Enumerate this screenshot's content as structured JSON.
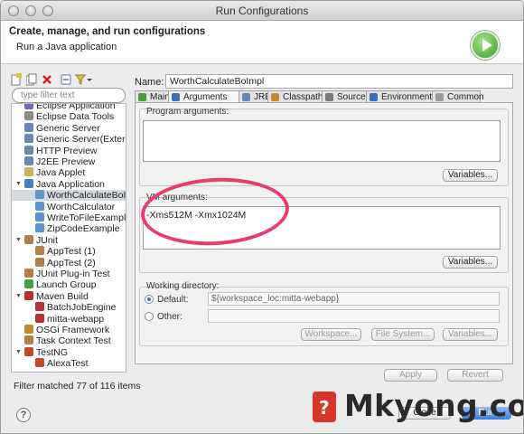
{
  "window": {
    "title": "Run Configurations"
  },
  "header": {
    "title": "Create, manage, and run configurations",
    "subtitle": "Run a Java application",
    "run_icon": "run-play-icon"
  },
  "left": {
    "toolbar_icons": [
      "new-config-icon",
      "duplicate-icon",
      "delete-icon",
      "collapse-all-icon",
      "filter-icon",
      "dropdown-icon"
    ],
    "filter_placeholder": "type filter text",
    "tree": [
      {
        "label": "Eclipse Application",
        "level": 1,
        "color": "#7b63c8"
      },
      {
        "label": "Eclipse Data Tools",
        "level": 1,
        "color": "#8a8a8a"
      },
      {
        "label": "Generic Server",
        "level": 1,
        "color": "#6b86b0"
      },
      {
        "label": "Generic Server(External L",
        "level": 1,
        "color": "#6b86b0"
      },
      {
        "label": "HTTP Preview",
        "level": 1,
        "color": "#6b86b0"
      },
      {
        "label": "J2EE Preview",
        "level": 1,
        "color": "#6b86b0"
      },
      {
        "label": "Java Applet",
        "level": 1,
        "color": "#c9b25a"
      },
      {
        "label": "Java Application",
        "level": 1,
        "color": "#4a7fc1",
        "expanded": true
      },
      {
        "label": "WorthCalculateBoImpl",
        "level": 2,
        "color": "#5d94cf",
        "selected": true
      },
      {
        "label": "WorthCalculator",
        "level": 2,
        "color": "#5d94cf"
      },
      {
        "label": "WriteToFileExample",
        "level": 2,
        "color": "#5d94cf"
      },
      {
        "label": "ZipCodeExample",
        "level": 2,
        "color": "#5d94cf"
      },
      {
        "label": "JUnit",
        "level": 1,
        "color": "#b0804b",
        "expanded": true
      },
      {
        "label": "AppTest (1)",
        "level": 2,
        "color": "#b0804b"
      },
      {
        "label": "AppTest (2)",
        "level": 2,
        "color": "#b0804b"
      },
      {
        "label": "JUnit Plug-in Test",
        "level": 1,
        "color": "#b0804b"
      },
      {
        "label": "Launch Group",
        "level": 1,
        "color": "#3aa43a"
      },
      {
        "label": "Maven Build",
        "level": 1,
        "color": "#b43232",
        "expanded": true
      },
      {
        "label": "BatchJobEngine",
        "level": 2,
        "color": "#b43232"
      },
      {
        "label": "mitta-webapp",
        "level": 2,
        "color": "#b43232"
      },
      {
        "label": "OSGi Framework",
        "level": 1,
        "color": "#c28a2e"
      },
      {
        "label": "Task Context Test",
        "level": 1,
        "color": "#b0804b"
      },
      {
        "label": "TestNG",
        "level": 1,
        "color": "#c04a2a",
        "expanded": true
      },
      {
        "label": "AlexaTest",
        "level": 2,
        "color": "#c04a2a"
      }
    ],
    "filter_status": "Filter matched 77 of 116 items"
  },
  "config": {
    "name_label": "Name:",
    "name_value": "WorthCalculateBoImpl",
    "tabs": [
      {
        "label": "Main",
        "icon": "main-tab-icon",
        "color": "#4a9a3a"
      },
      {
        "label": "Arguments",
        "icon": "arguments-tab-icon",
        "color": "#3b6fb5",
        "active": true
      },
      {
        "label": "JRE",
        "icon": "jre-tab-icon",
        "color": "#6a86b5"
      },
      {
        "label": "Classpath",
        "icon": "classpath-tab-icon",
        "color": "#c28a2e"
      },
      {
        "label": "Source",
        "icon": "source-tab-icon",
        "color": "#7a7a7a"
      },
      {
        "label": "Environment",
        "icon": "environment-tab-icon",
        "color": "#3b6fb5"
      },
      {
        "label": "Common",
        "icon": "common-tab-icon",
        "color": "#9a9a9a"
      }
    ],
    "program_args_label": "Program arguments:",
    "program_args_value": "",
    "vm_args_label": "VM arguments:",
    "vm_args_value": "-Xms512M -Xmx1024M",
    "variables_label": "Variables...",
    "working_dir_label": "Working directory:",
    "default_label": "Default:",
    "default_value": "${workspace_loc:mitta-webapp}",
    "other_label": "Other:",
    "other_value": "",
    "workspace_label": "Workspace...",
    "filesystem_label": "File System...",
    "apply_label": "Apply",
    "revert_label": "Revert"
  },
  "footer": {
    "help": "?",
    "close_label": "Close",
    "run_label": "Run",
    "watermark": "Mkyong.com",
    "watermark_logo": "?"
  }
}
